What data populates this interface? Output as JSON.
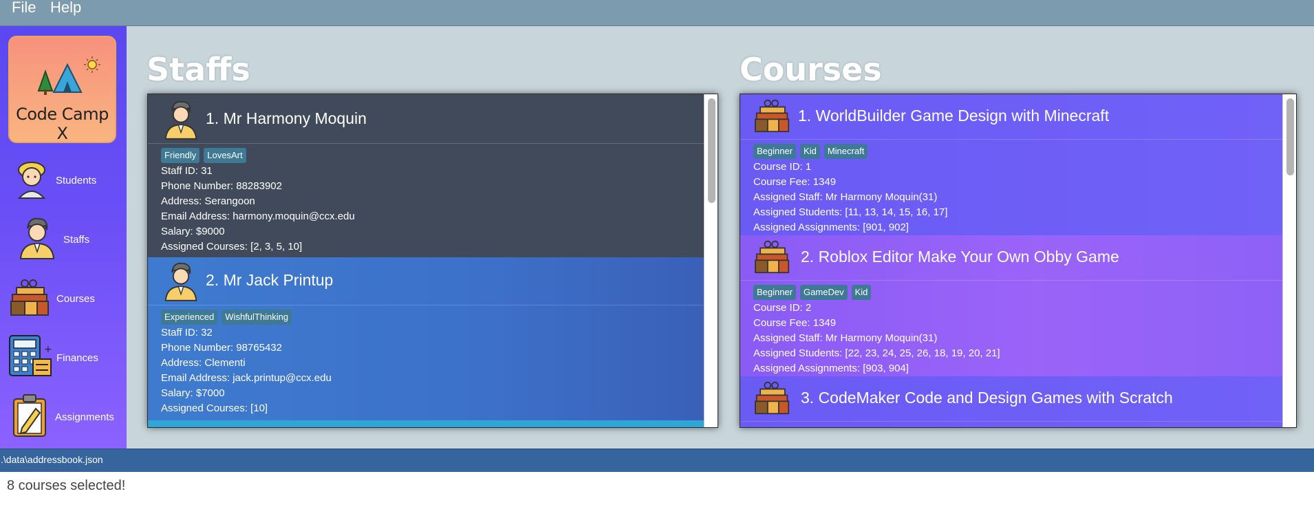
{
  "menu": {
    "file": "File",
    "help": "Help"
  },
  "sidebar": {
    "logo_text": "Code Camp X",
    "items": [
      {
        "label": "Students",
        "icon": "student-icon"
      },
      {
        "label": "Staffs",
        "icon": "staff-icon"
      },
      {
        "label": "Courses",
        "icon": "books-icon"
      },
      {
        "label": "Finances",
        "icon": "calculator-icon"
      },
      {
        "label": "Assignments",
        "icon": "clipboard-icon"
      }
    ]
  },
  "staffs": {
    "title": "Staffs",
    "cards": [
      {
        "title": "1.  Mr Harmony Moquin",
        "tags": [
          "Friendly",
          "LovesArt"
        ],
        "lines": [
          "Staff ID: 31",
          "Phone Number: 88283902",
          "Address: Serangoon",
          "Email Address: harmony.moquin@ccx.edu",
          "Salary: $9000",
          "Assigned Courses: [2, 3, 5, 10]"
        ]
      },
      {
        "title": "2.  Mr Jack Printup",
        "tags": [
          "Experienced",
          "WishfulThinking"
        ],
        "lines": [
          "Staff ID: 32",
          "Phone Number: 98765432",
          "Address: Clementi",
          "Email Address: jack.printup@ccx.edu",
          "Salary: $7000",
          "Assigned Courses: [10]"
        ]
      }
    ]
  },
  "courses": {
    "title": "Courses",
    "cards": [
      {
        "title": "1.  WorldBuilder Game Design with Minecraft",
        "tags": [
          "Beginner",
          "Kid",
          "Minecraft"
        ],
        "lines": [
          "Course ID: 1",
          "Course Fee: 1349",
          "Assigned Staff: Mr Harmony Moquin(31)",
          "Assigned Students: [11, 13, 14, 15, 16, 17]",
          "Assigned Assignments: [901, 902]"
        ]
      },
      {
        "title": "2.  Roblox Editor Make Your Own Obby Game",
        "tags": [
          "Beginner",
          "GameDev",
          "Kid"
        ],
        "lines": [
          "Course ID: 2",
          "Course Fee: 1349",
          "Assigned Staff: Mr Harmony Moquin(31)",
          "Assigned Students: [22, 23, 24, 25, 26, 18, 19, 20, 21]",
          "Assigned Assignments: [903, 904]"
        ]
      },
      {
        "title": "3.  CodeMaker Code and Design Games with Scratch",
        "tags": [],
        "lines": []
      }
    ]
  },
  "status": {
    "path": ".\\data\\addressbook.json"
  },
  "result": {
    "message": "8 courses selected!"
  }
}
